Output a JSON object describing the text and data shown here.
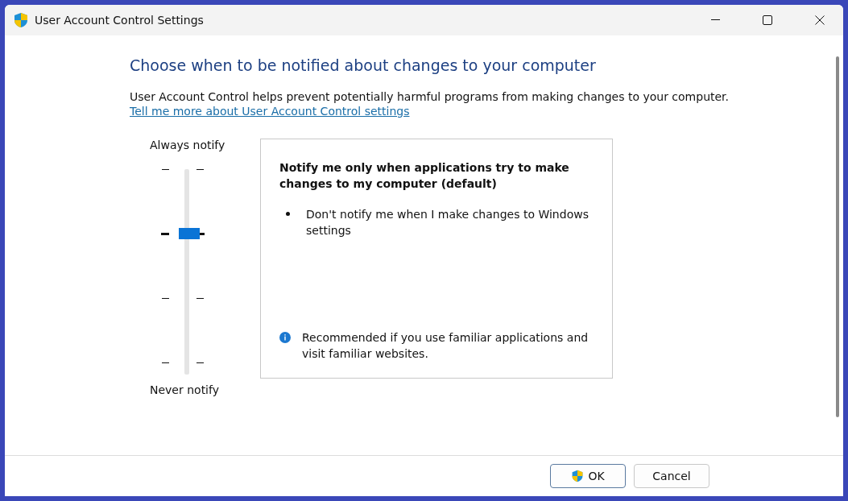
{
  "window": {
    "title": "User Account Control Settings"
  },
  "heading": "Choose when to be notified about changes to your computer",
  "description": "User Account Control helps prevent potentially harmful programs from making changes to your computer.",
  "link": "Tell me more about User Account Control settings",
  "slider": {
    "top_label": "Always notify",
    "bottom_label": "Never notify",
    "level": 0.667
  },
  "info_panel": {
    "title": "Notify me only when applications try to make changes to my computer (default)",
    "bullets": [
      "Don't notify me when I make changes to Windows settings"
    ],
    "note": "Recommended if you use familiar applications and visit familiar websites."
  },
  "buttons": [
    {
      "label": "OK",
      "kind": "shield"
    },
    {
      "label": "Cancel",
      "kind": "plain"
    }
  ]
}
